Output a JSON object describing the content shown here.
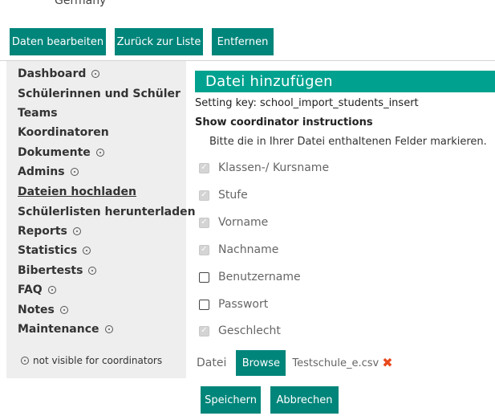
{
  "header": {
    "country": "Germany"
  },
  "toolbar": {
    "edit_label": "Daten bearbeiten",
    "back_label": "Zurück zur Liste",
    "remove_label": "Entfernen"
  },
  "sidebar": {
    "items": [
      {
        "label": "Dashboard",
        "restricted": true
      },
      {
        "label": "Schülerinnen und Schüler",
        "restricted": false
      },
      {
        "label": "Teams",
        "restricted": false
      },
      {
        "label": "Koordinatoren",
        "restricted": false
      },
      {
        "label": "Dokumente",
        "restricted": true
      },
      {
        "label": "Admins",
        "restricted": true
      },
      {
        "label": "Dateien hochladen",
        "restricted": false,
        "active": true
      },
      {
        "label": "Schülerlisten herunterladen",
        "restricted": false
      },
      {
        "label": "Reports",
        "restricted": true
      },
      {
        "label": "Statistics",
        "restricted": true
      },
      {
        "label": "Bibertests",
        "restricted": true
      },
      {
        "label": "FAQ",
        "restricted": true
      },
      {
        "label": "Notes",
        "restricted": true
      },
      {
        "label": "Maintenance",
        "restricted": true
      }
    ],
    "legend": "not visible for coordinators"
  },
  "main": {
    "title": "Datei hinzufügen",
    "setting_key": "Setting key: school_import_students_insert",
    "show_instructions": "Show coordinator instructions",
    "instructions": "Bitte die in Ihrer Datei enthaltenen Felder markieren.",
    "fields": [
      {
        "label": "Klassen-/ Kursname",
        "checked": true,
        "disabled": true
      },
      {
        "label": "Stufe",
        "checked": true,
        "disabled": true
      },
      {
        "label": "Vorname",
        "checked": true,
        "disabled": true
      },
      {
        "label": "Nachname",
        "checked": true,
        "disabled": true
      },
      {
        "label": "Benutzername",
        "checked": false,
        "disabled": false
      },
      {
        "label": "Passwort",
        "checked": false,
        "disabled": false
      },
      {
        "label": "Geschlecht",
        "checked": true,
        "disabled": true
      }
    ],
    "file": {
      "label": "Datei",
      "browse_label": "Browse",
      "file_name": "Testschule_e.csv"
    }
  },
  "actions": {
    "save_label": "Speichern",
    "cancel_label": "Abbrechen"
  },
  "colors": {
    "primary_button": "#00857a",
    "title_bar": "#00a28f",
    "sidebar_bg": "#eeeeee",
    "remove_icon": "#e8491d"
  }
}
